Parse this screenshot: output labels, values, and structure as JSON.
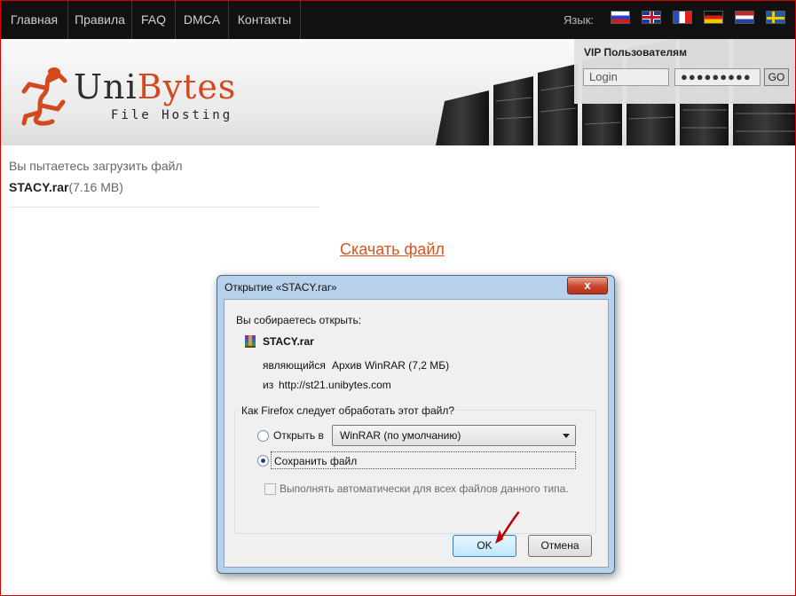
{
  "nav": {
    "items": [
      {
        "label": "Главная"
      },
      {
        "label": "Правила"
      },
      {
        "label": "FAQ"
      },
      {
        "label": "DMCA"
      },
      {
        "label": "Контакты"
      }
    ],
    "language_label": "Язык:",
    "flags": [
      "ru-flag-icon",
      "uk-flag-icon",
      "fr-flag-icon",
      "de-flag-icon",
      "nl-flag-icon",
      "se-flag-icon"
    ]
  },
  "header": {
    "logo_uni": "Uni",
    "logo_bytes": "Bytes",
    "logo_sub": "File Hosting"
  },
  "vip": {
    "title": "VIP Пользователям",
    "login_placeholder": "Login",
    "password_mask": "●●●●●●●●●",
    "go_label": "GO"
  },
  "content": {
    "intro": "Вы пытаетесь загрузить файл",
    "file_name": "STACY.rar",
    "file_size": "(7.16 MB)",
    "download_link": "Скачать файл"
  },
  "dialog": {
    "title": "Открытие «STACY.rar»",
    "close_label": "x",
    "about_to_open": "Вы собираетесь открыть:",
    "file_name": "STACY.rar",
    "type_label": "являющийся",
    "type_value": "Архив WinRAR (7,2 МБ)",
    "from_label": "из",
    "from_value": "http://st21.unibytes.com",
    "group_legend": "Как Firefox следует обработать этот файл?",
    "open_with_label": "Открыть в",
    "open_with_value": "WinRAR (по умолчанию)",
    "save_label": "Сохранить файл",
    "auto_label": "Выполнять автоматически для всех файлов данного типа.",
    "ok_label": "OK",
    "cancel_label": "Отмена",
    "selected_option": "save"
  },
  "colors": {
    "accent": "#d9541f",
    "nav_bg": "#111111",
    "dialog_frame": "#b8d1ea",
    "annotation_arrow": "#c00000"
  }
}
